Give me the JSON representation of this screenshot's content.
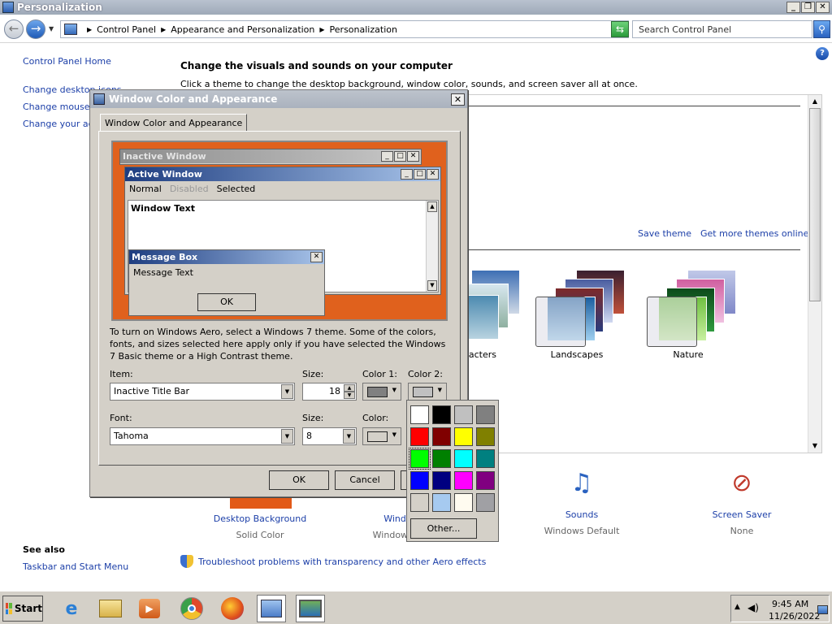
{
  "window": {
    "title": "Personalization",
    "controls": {
      "minimize": "_",
      "maximize": "❐",
      "close": "✕"
    }
  },
  "address": {
    "crumbs": [
      "Control Panel",
      "Appearance and Personalization",
      "Personalization"
    ],
    "search_placeholder": "Search Control Panel"
  },
  "left_pane": {
    "home": "Control Panel Home",
    "links": [
      "Change desktop icons",
      "Change mouse pointers",
      "Change your account picture"
    ],
    "see_also": "See also",
    "taskbar_link": "Taskbar and Start Menu"
  },
  "main": {
    "heading": "Change the visuals and sounds on your computer",
    "subheading": "Click a theme to change the desktop background, window color, sounds, and screen saver all at once.",
    "save_theme": "Save theme",
    "more_themes": "Get more themes online",
    "themes": [
      "Characters",
      "Landscapes",
      "Nature"
    ],
    "bottom": [
      {
        "label": "Desktop Background",
        "sub": "Solid Color"
      },
      {
        "label": "Window Color",
        "sub": "Windows Standard"
      },
      {
        "label": "Sounds",
        "sub": "Windows Default"
      },
      {
        "label": "Screen Saver",
        "sub": "None"
      }
    ],
    "troubleshoot": "Troubleshoot problems with transparency and other Aero effects"
  },
  "dialog": {
    "title": "Window Color and Appearance",
    "tab": "Window Color and Appearance",
    "preview": {
      "inactive_title": "Inactive Window",
      "active_title": "Active Window",
      "menu": [
        "Normal",
        "Disabled",
        "Selected"
      ],
      "window_text": "Window Text",
      "msgbox_title": "Message Box",
      "msgbox_text": "Message Text",
      "msgbox_ok": "OK"
    },
    "aero_note": "To turn on Windows Aero, select a Windows 7 theme.  Some of the colors, fonts, and sizes selected here apply only if you have selected the Windows 7 Basic theme or a High Contrast theme.",
    "item_label": "Item:",
    "item_value": "Inactive Title Bar",
    "size_label": "Size:",
    "size_value": "18",
    "color1_label": "Color 1:",
    "color2_label": "Color 2:",
    "font_label": "Font:",
    "font_value": "Tahoma",
    "font_size_label": "Size:",
    "font_size_value": "8",
    "color_label": "Color:",
    "ok": "OK",
    "cancel": "Cancel"
  },
  "picker": {
    "colors": [
      "#ffffff",
      "#000000",
      "#c0c0c0",
      "#808080",
      "#ff0000",
      "#800000",
      "#ffff00",
      "#808000",
      "#00ff00",
      "#008000",
      "#00ffff",
      "#008080",
      "#0000ff",
      "#000080",
      "#ff00ff",
      "#800080",
      "#d4d0c8",
      "#a6caf0",
      "#fffbf0",
      "#a0a0a4"
    ],
    "other": "Other..."
  },
  "taskbar": {
    "start": "Start",
    "time": "9:45 AM",
    "date": "11/26/2022"
  },
  "colors": {
    "accent_orange": "#e25a18",
    "link_blue": "#1c3fa8"
  }
}
